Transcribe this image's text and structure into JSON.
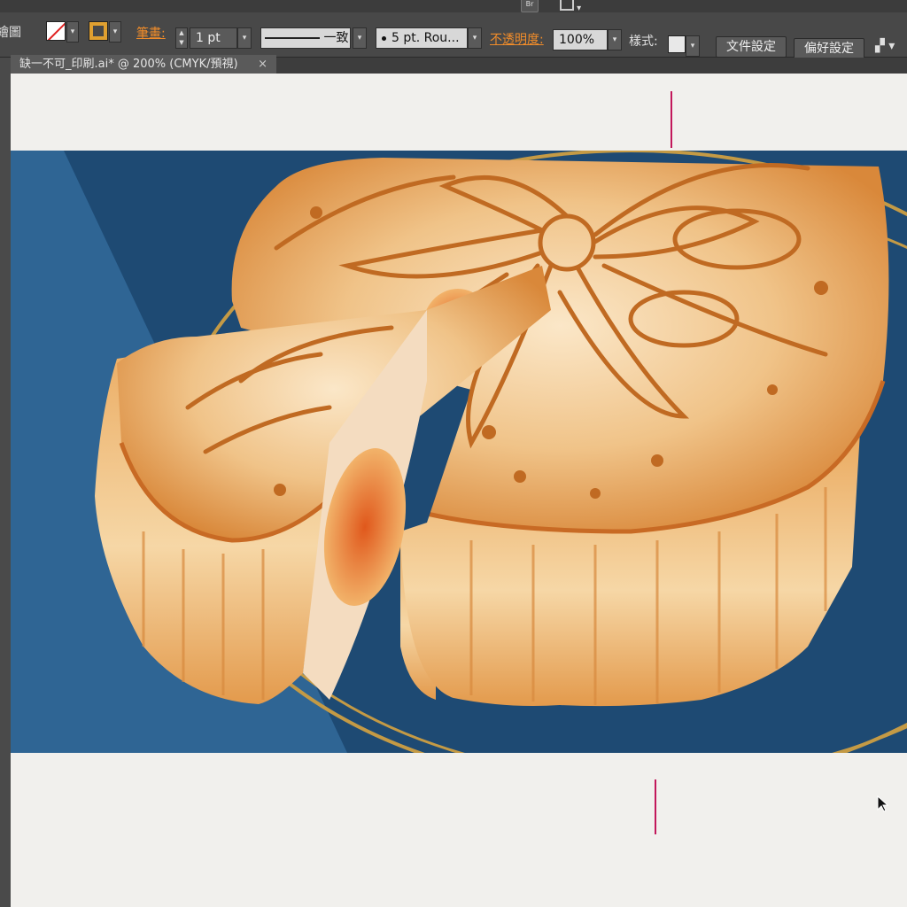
{
  "menu": {
    "items": [
      "",
      "",
      "",
      "",
      "",
      "",
      "",
      "",
      ""
    ],
    "br_label": "Br"
  },
  "controlbar": {
    "left_label": "繪圖",
    "stroke_label": "筆畫:",
    "stroke_weight": "1 pt",
    "line_profile": "一致",
    "brush": "5 pt. Rou...",
    "opacity_label": "不透明度:",
    "opacity_value": "100%",
    "style_label": "樣式:",
    "doc_setup_button": "文件設定",
    "prefs_button": "偏好設定"
  },
  "document": {
    "tab_title": "缺一不可_印刷.ai* @ 200% (CMYK/預視)",
    "close_glyph": "×"
  },
  "colors": {
    "panel_bg": "#484848",
    "highlight_label": "#f08c2a",
    "artboard_navy": "#1e4a73",
    "ring_gold": "#c49a45",
    "trim_mark": "#c2185b",
    "pastry_orange": "#e29a4a"
  },
  "icons": [
    "fill-none-icon",
    "stroke-swatch-icon",
    "stepper-icon",
    "arrange-documents-icon",
    "dock-icon",
    "mouse-cursor-icon"
  ]
}
